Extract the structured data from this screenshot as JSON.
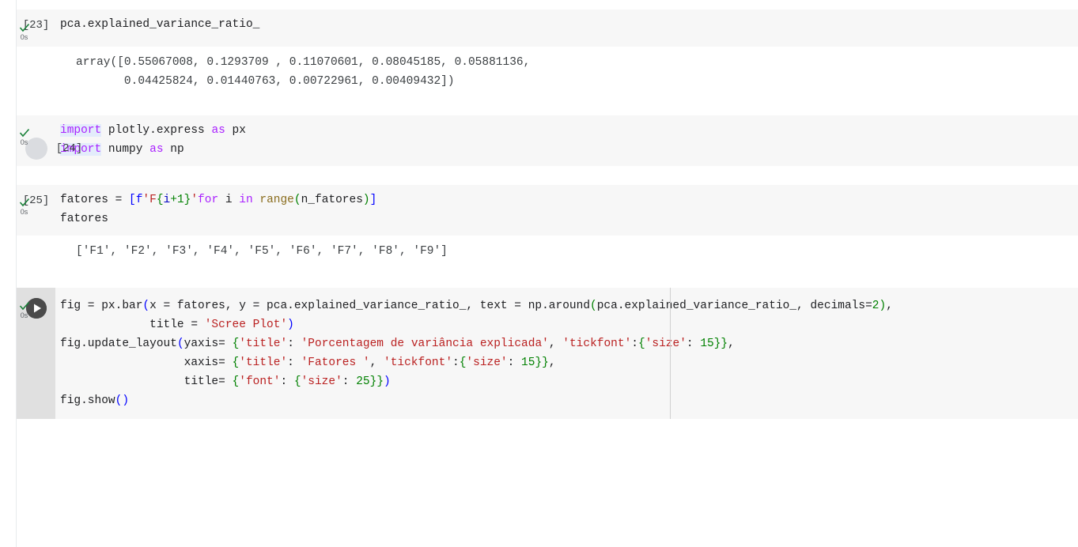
{
  "notebook": {
    "cells": [
      {
        "id": "cell-23",
        "exec_label": "[23]",
        "status_time": "0s",
        "status_icon": "check-icon",
        "code_plain": "pca.explained_variance_ratio_",
        "output_lines": [
          "array([0.55067008, 0.1293709 , 0.11070601, 0.08045185, 0.05881136,",
          "       0.04425824, 0.01440763, 0.00722961, 0.00409432])"
        ]
      },
      {
        "id": "cell-24",
        "exec_label": "[24]",
        "status_time": "0s",
        "status_icon": "check-icon",
        "code_plain": "import plotly.express as px\nimport numpy as np",
        "output_lines": []
      },
      {
        "id": "cell-25",
        "exec_label": "[25]",
        "status_time": "0s",
        "status_icon": "check-icon",
        "code_plain": "fatores = [f'F{i+1}'for i in range(n_fatores)]\nfatores",
        "output_lines": [
          "['F1', 'F2', 'F3', 'F4', 'F5', 'F6', 'F7', 'F8', 'F9']"
        ]
      },
      {
        "id": "cell-26",
        "exec_label": "",
        "status_time": "0s",
        "status_icon": "check-icon",
        "run_icon": "play-icon",
        "code_plain": "fig = px.bar(x = fatores, y = pca.explained_variance_ratio_, text = np.around(pca.explained_variance_ratio_, decimals=2),\n             title = 'Scree Plot')\nfig.update_layout(yaxis= {'title': 'Porcentagem de variância explicada', 'tickfont':{'size': 15}},\n                  xaxis= {'title': 'Fatores ', 'tickfont':{'size': 15}},\n                  title= {'font': {'size': 25}})\nfig.show()",
        "output_lines": []
      }
    ],
    "code_tokens": {
      "c23": {
        "l1": "pca.explained_variance_ratio_"
      },
      "c24": {
        "kw1": "import",
        "mod1": " plotly.express ",
        "kw2": "as",
        "alias1": " px",
        "kw3": "import",
        "mod2": " numpy ",
        "kw4": "as",
        "alias2": " np"
      },
      "c25": {
        "name": "fatores = ",
        "lb": "[",
        "f": "f",
        "q1": "'",
        "F": "F",
        "ob": "{",
        "i": "i",
        "plus": "+",
        "one": "1",
        "cb": "}",
        "q2": "'",
        "forkw": "for",
        "ivar": " i ",
        "inkw": "in",
        "sp": " ",
        "range": "range",
        "op": "(",
        "arg": "n_fatores",
        "cp": ")",
        "rb": "]",
        "l2": "fatores"
      },
      "c26": {
        "a1": "fig = px.bar",
        "a2": "(",
        "a3": "x = fatores, y = pca.explained_variance_ratio_, text = np.around",
        "a4": "(",
        "a5": "pca.explained_variance_ratio_, decimals=",
        "a6": "2",
        "a7": ")",
        "a8": ",",
        "b1": "             title = ",
        "b2": "'Scree Plot'",
        "b3": ")",
        "c1": "fig.update_layout",
        "c2": "(",
        "c3": "yaxis= ",
        "c4": "{",
        "c5": "'title'",
        "c6": ": ",
        "c7": "'Porcentagem de variância explicada'",
        "c8": ", ",
        "c9": "'tickfont'",
        "c10": ":",
        "c11": "{",
        "c12": "'size'",
        "c13": ": ",
        "c14": "15",
        "c15": "}",
        "c16": "}",
        "c17": ",",
        "d1": "                  xaxis= ",
        "d2": "{",
        "d3": "'title'",
        "d4": ": ",
        "d5": "'Fatores '",
        "d6": ", ",
        "d7": "'tickfont'",
        "d8": ":",
        "d9": "{",
        "d10": "'size'",
        "d11": ": ",
        "d12": "15",
        "d13": "}",
        "d14": "}",
        "d15": ",",
        "e1": "                  title= ",
        "e2": "{",
        "e3": "'font'",
        "e4": ": ",
        "e5": "{",
        "e6": "'size'",
        "e7": ": ",
        "e8": "25",
        "e9": "}",
        "e10": "}",
        "e11": ")",
        "f1": "fig.show",
        "f2": "()"
      }
    },
    "colors": {
      "keyword": "#aa22ff",
      "string": "#ba2121",
      "number": "#008000",
      "function": "#8a6d1e",
      "paren_blue": "#0000ff",
      "brace_green": "#008000",
      "cell_bg": "#f7f7f7",
      "gutter_bg": "#e0e0e0",
      "status_check": "#188038",
      "run_button": "#4a4a4a"
    }
  }
}
